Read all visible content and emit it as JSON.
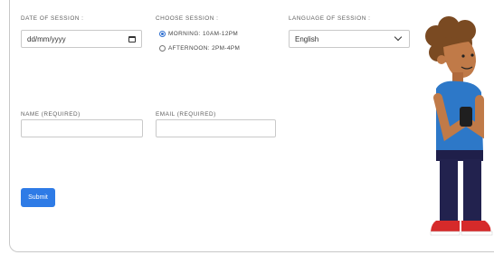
{
  "form": {
    "date_label": "DATE OF SESSION :",
    "date_placeholder": "dd/mm/yyyy",
    "session_label": "CHOOSE SESSION :",
    "sessions": [
      {
        "label": "MORNING: 10AM-12PM",
        "selected": true
      },
      {
        "label": "AFTERNOON: 2PM-4PM",
        "selected": false
      }
    ],
    "language_label": "LANGUAGE OF SESSION :",
    "language_value": "English",
    "name_label": "NAME (REQUIRED)",
    "email_label": "EMAIL (REQUIRED)",
    "submit_label": "Submit"
  },
  "icons": {
    "date_picker": "calendar-icon",
    "language_dropdown": "chevron-down-icon"
  },
  "colors": {
    "accent": "#2e7be6",
    "radio_selected": "#2f6fd0",
    "border": "#c9c9c9"
  }
}
